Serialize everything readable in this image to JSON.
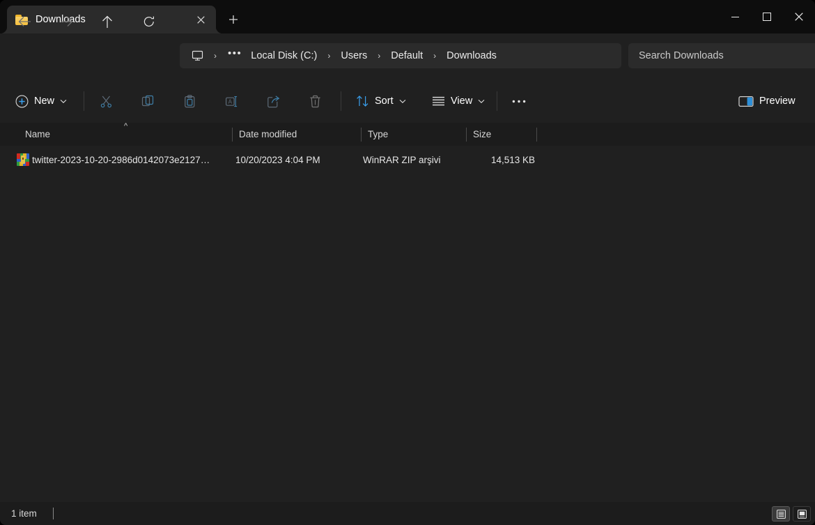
{
  "window": {
    "tab": {
      "title": "Downloads",
      "folder_icon": "folder-icon",
      "close_icon": "close-icon"
    },
    "newtab_icon": "plus-icon",
    "controls": {
      "minimize": "minimize-icon",
      "maximize": "maximize-icon",
      "close": "close-icon"
    }
  },
  "navigation": {
    "back": "back-arrow-icon",
    "forward": "forward-arrow-icon",
    "up": "up-arrow-icon",
    "refresh": "refresh-icon"
  },
  "breadcrumb": {
    "root_icon": "monitor-icon",
    "overflow": "•••",
    "items": [
      {
        "label": "Local Disk (C:)"
      },
      {
        "label": "Users"
      },
      {
        "label": "Default"
      },
      {
        "label": "Downloads"
      }
    ],
    "separator": "›"
  },
  "search": {
    "placeholder": "Search Downloads"
  },
  "toolbar": {
    "new_label": "New",
    "new_icon": "plus-circle-icon",
    "cut_icon": "scissors-icon",
    "copy_icon": "copy-icon",
    "paste_icon": "paste-icon",
    "rename_icon": "rename-icon",
    "share_icon": "share-icon",
    "delete_icon": "trash-icon",
    "sort_label": "Sort",
    "sort_icon": "sort-arrows-icon",
    "view_label": "View",
    "view_icon": "view-lines-icon",
    "more_label": "•••",
    "preview_label": "Preview",
    "preview_icon": "preview-pane-icon",
    "accent_color": "#4cb3f5"
  },
  "columns": [
    {
      "key": "name",
      "label": "Name",
      "sorted": true,
      "sort_direction": "ascending"
    },
    {
      "key": "date",
      "label": "Date modified"
    },
    {
      "key": "type",
      "label": "Type"
    },
    {
      "key": "size",
      "label": "Size"
    }
  ],
  "files": [
    {
      "icon": "winrar-archive-icon",
      "name": "twitter-2023-10-20-2986d0142073e2127…",
      "date": "10/20/2023 4:04 PM",
      "type": "WinRAR ZIP arşivi",
      "size": "14,513 KB"
    }
  ],
  "status": {
    "item_count": "1 item",
    "view_details_icon": "details-view-icon",
    "view_icons_icon": "large-icons-view-icon"
  }
}
